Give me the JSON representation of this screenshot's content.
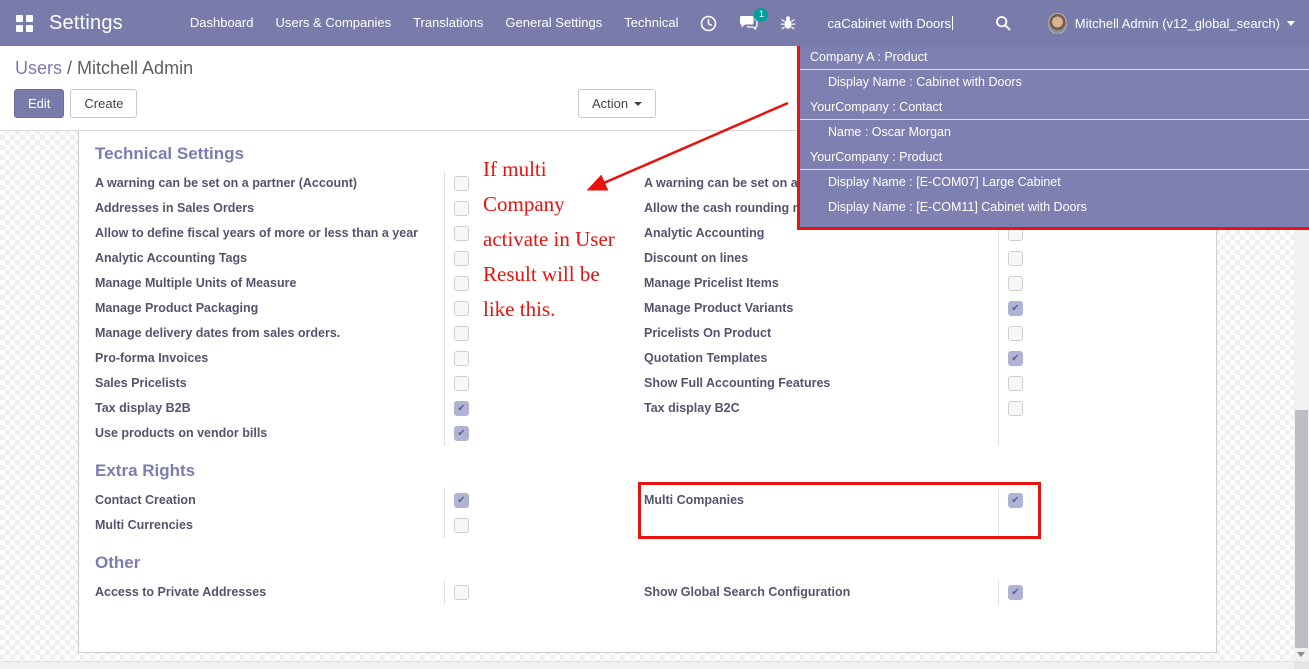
{
  "navbar": {
    "title": "Settings",
    "menu_items": [
      "Dashboard",
      "Users & Companies",
      "Translations",
      "General Settings",
      "Technical"
    ],
    "message_badge": "1",
    "search_value": "caCabinet with Doors",
    "user_name": "Mitchell Admin (v12_global_search)"
  },
  "icons": {
    "apps": "grid",
    "activities": "clock",
    "messages": "chat-bubble",
    "debug": "bug",
    "search": "magnifier",
    "user_menu": "caret-down"
  },
  "colors": {
    "navbar_purple": "#797cab",
    "accent_purple": "#7c7bad",
    "annotation_red": "#e8120e",
    "badge_green": "#00a09d"
  },
  "breadcrumb": {
    "parent": "Users",
    "separator": " / ",
    "current": "Mitchell Admin"
  },
  "buttons": {
    "edit": "Edit",
    "create": "Create",
    "action": "Action"
  },
  "search_dropdown": {
    "groups": [
      {
        "header": "Company A : Product",
        "items": [
          "Display Name : Cabinet with Doors"
        ]
      },
      {
        "header": "YourCompany : Contact",
        "items": [
          "Name : Oscar Morgan"
        ]
      },
      {
        "header": "YourCompany : Product",
        "items": [
          "Display Name : [E-COM07] Large Cabinet",
          "Display Name : [E-COM11] Cabinet with Doors"
        ]
      }
    ]
  },
  "annotation": {
    "note_lines": [
      "If multi",
      "Company",
      "activate in User",
      "Result will be",
      "like this."
    ]
  },
  "sections": [
    {
      "title": "Technical Settings",
      "rows": [
        {
          "left": {
            "label": "A warning can be set on a partner (Account)",
            "checked": false
          },
          "right": {
            "label": "A warning can be set on a",
            "checked": false
          }
        },
        {
          "left": {
            "label": "Addresses in Sales Orders",
            "checked": false
          },
          "right": {
            "label": "Allow the cash rounding m",
            "checked": false
          }
        },
        {
          "left": {
            "label": "Allow to define fiscal years of more or less than a year",
            "checked": false
          },
          "right": {
            "label": "Analytic Accounting",
            "checked": false
          }
        },
        {
          "left": {
            "label": "Analytic Accounting Tags",
            "checked": false
          },
          "right": {
            "label": "Discount on lines",
            "checked": false
          }
        },
        {
          "left": {
            "label": "Manage Multiple Units of Measure",
            "checked": false
          },
          "right": {
            "label": "Manage Pricelist Items",
            "checked": false
          }
        },
        {
          "left": {
            "label": "Manage Product Packaging",
            "checked": false
          },
          "right": {
            "label": "Manage Product Variants",
            "checked": true
          }
        },
        {
          "left": {
            "label": "Manage delivery dates from sales orders.",
            "checked": false
          },
          "right": {
            "label": "Pricelists On Product",
            "checked": false
          }
        },
        {
          "left": {
            "label": "Pro-forma Invoices",
            "checked": false
          },
          "right": {
            "label": "Quotation Templates",
            "checked": true
          }
        },
        {
          "left": {
            "label": "Sales Pricelists",
            "checked": false
          },
          "right": {
            "label": "Show Full Accounting Features",
            "checked": false
          }
        },
        {
          "left": {
            "label": "Tax display B2B",
            "checked": true
          },
          "right": {
            "label": "Tax display B2C",
            "checked": false
          }
        },
        {
          "left": {
            "label": "Use products on vendor bills",
            "checked": true
          },
          "right": {
            "label": "",
            "checked": null
          }
        }
      ]
    },
    {
      "title": "Extra Rights",
      "rows": [
        {
          "left": {
            "label": "Contact Creation",
            "checked": true
          },
          "right": {
            "label": "Multi Companies",
            "checked": true
          }
        },
        {
          "left": {
            "label": "Multi Currencies",
            "checked": false
          },
          "right": {
            "label": "",
            "checked": null
          }
        }
      ]
    },
    {
      "title": "Other",
      "rows": [
        {
          "left": {
            "label": "Access to Private Addresses",
            "checked": false
          },
          "right": {
            "label": "Show Global Search Configuration",
            "checked": true
          }
        }
      ]
    }
  ]
}
